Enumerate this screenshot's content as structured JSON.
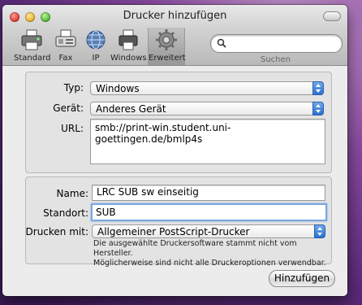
{
  "window": {
    "title": "Drucker hinzufügen"
  },
  "toolbar": {
    "items": [
      {
        "label": "Standard",
        "icon": "printer-default-icon"
      },
      {
        "label": "Fax",
        "icon": "fax-icon"
      },
      {
        "label": "IP",
        "icon": "globe-icon"
      },
      {
        "label": "Windows",
        "icon": "windows-printer-icon"
      },
      {
        "label": "Erweitert",
        "icon": "gear-icon",
        "selected": true
      }
    ],
    "search_label": "Suchen",
    "search_placeholder": ""
  },
  "connection": {
    "type_label": "Typ:",
    "type_value": "Windows",
    "device_label": "Gerät:",
    "device_value": "Anderes Gerät",
    "url_label": "URL:",
    "url_value": "smb://print-win.student.uni-goettingen.de/bmlp4s"
  },
  "printer": {
    "name_label": "Name:",
    "name_value": "LRC SUB sw einseitig",
    "location_label": "Standort:",
    "location_value": "SUB",
    "driver_label": "Drucken mit:",
    "driver_value": "Allgemeiner PostScript-Drucker",
    "note_line1": "Die ausgewählte Druckersoftware stammt nicht vom Hersteller.",
    "note_line2": "Möglicherweise sind nicht alle Druckeroptionen verwendbar."
  },
  "actions": {
    "add_label": "Hinzufügen"
  },
  "colors": {
    "accent_blue": "#2a6fd2",
    "focus_ring": "#7ba7e1"
  }
}
